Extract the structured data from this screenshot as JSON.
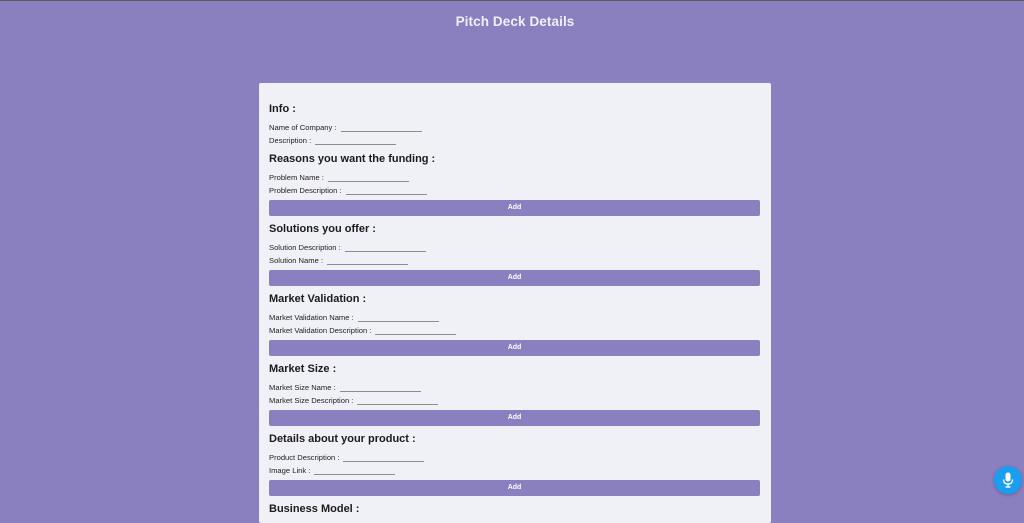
{
  "page": {
    "title": "Pitch Deck Details"
  },
  "form": {
    "sections": [
      {
        "heading": "Info :",
        "fields": [
          "Name of Company :",
          "Description :"
        ],
        "add_label": null
      },
      {
        "heading": "Reasons you want the funding :",
        "fields": [
          "Problem Name :",
          "Problem Description :"
        ],
        "add_label": "Add"
      },
      {
        "heading": "Solutions you offer :",
        "fields": [
          "Solution Description :",
          "Solution Name :"
        ],
        "add_label": "Add"
      },
      {
        "heading": "Market Validation :",
        "fields": [
          "Market Validation Name :",
          "Market Validation Description :"
        ],
        "add_label": "Add"
      },
      {
        "heading": "Market Size :",
        "fields": [
          "Market Size Name :",
          "Market Size Description :"
        ],
        "add_label": "Add"
      },
      {
        "heading": "Details about your product :",
        "fields": [
          "Product Description :",
          "Image Link :"
        ],
        "add_label": "Add"
      },
      {
        "heading": "Business Model :",
        "fields": [],
        "add_label": null
      }
    ]
  },
  "voice": {
    "icon": "microphone-icon",
    "color": "#1a9ef2"
  },
  "colors": {
    "background": "#8a7fbf",
    "card": "#f0f0f7",
    "button": "#8a7fbf"
  }
}
